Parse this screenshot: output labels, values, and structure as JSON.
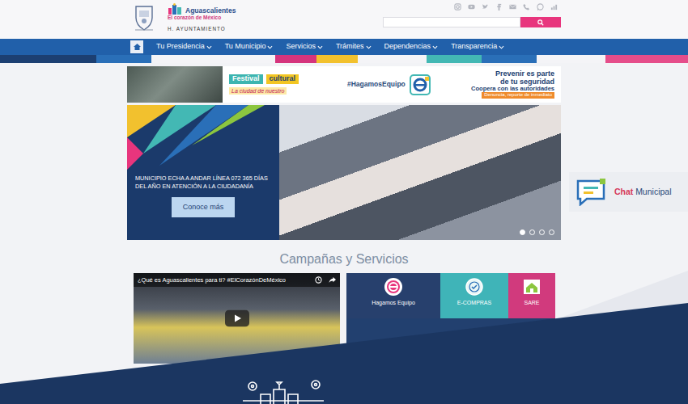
{
  "header": {
    "logo_title": "Aguascalientes",
    "logo_subtitle": "El corazón de México",
    "logo_org": "H. AYUNTAMIENTO"
  },
  "nav": {
    "items": [
      {
        "label": "Tu Presidencia",
        "dropdown": true
      },
      {
        "label": "Tu Municipio",
        "dropdown": true
      },
      {
        "label": "Servicios",
        "dropdown": true
      },
      {
        "label": "Trámites",
        "dropdown": true
      },
      {
        "label": "Dependencias",
        "dropdown": true
      },
      {
        "label": "Transparencia",
        "dropdown": true
      }
    ]
  },
  "banner": {
    "festival_title": "Festival",
    "festival_subtitle": "cultural",
    "tagline": "La ciudad de nuestro",
    "hashtag": "#HagamosEquipo",
    "headline_1": "Prevenir es parte",
    "headline_2": "de tu seguridad",
    "cta": "Coopera con las autoridades",
    "note": "Denuncia, reporte de inmediato"
  },
  "carousel": {
    "caption": "MUNICIPIO ECHA A ANDAR LÍNEA 072 365 DÍAS DEL AÑO EN ATENCIÓN A LA CIUDADANÍA",
    "button": "Conoce más",
    "indicators": [
      {
        "selected": true
      },
      {
        "selected": false
      },
      {
        "selected": false
      },
      {
        "selected": false
      }
    ]
  },
  "chat": {
    "label_strong": "Chat",
    "label": "Municipal"
  },
  "section": {
    "title": "Campañas y Servicios"
  },
  "video": {
    "title": "¿Qué es Aguascalientes para ti? #ElCorazónDeMéxico"
  },
  "services": [
    {
      "label": "Hagamos Equipo",
      "kind": "campaign",
      "color": "#27406d"
    },
    {
      "label": "E-COMPRAS",
      "kind": "seal",
      "color": "#3fb4b8"
    },
    {
      "label": "SARE",
      "kind": "house",
      "color": "#d13a7d"
    }
  ]
}
